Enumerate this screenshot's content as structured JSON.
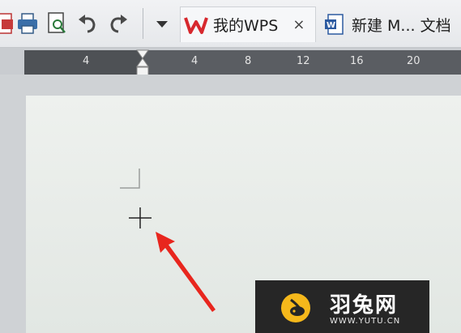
{
  "toolbar": {
    "icons": [
      "export-pdf-icon",
      "print-icon",
      "print-preview-icon",
      "undo-icon",
      "redo-icon",
      "dropdown-icon"
    ]
  },
  "tabs": [
    {
      "label": "我的WPS",
      "icon": "wps-logo-icon",
      "close": "×",
      "active": true
    },
    {
      "label": "新建 M... 文档",
      "icon": "word-doc-icon",
      "active": false
    }
  ],
  "ruler": {
    "labels": [
      "4",
      "4",
      "8",
      "12",
      "16",
      "20"
    ]
  },
  "watermark": {
    "title": "羽兔网",
    "url": "WWW.YUTU.CN"
  },
  "colors": {
    "wps_red": "#d7282e",
    "annotation_arrow": "#e8261e",
    "ruler_dark": "#4e5155",
    "page_bg": "#e8ece9",
    "watermark_bg": "#262626",
    "logo_yellow": "#f5b81b"
  }
}
